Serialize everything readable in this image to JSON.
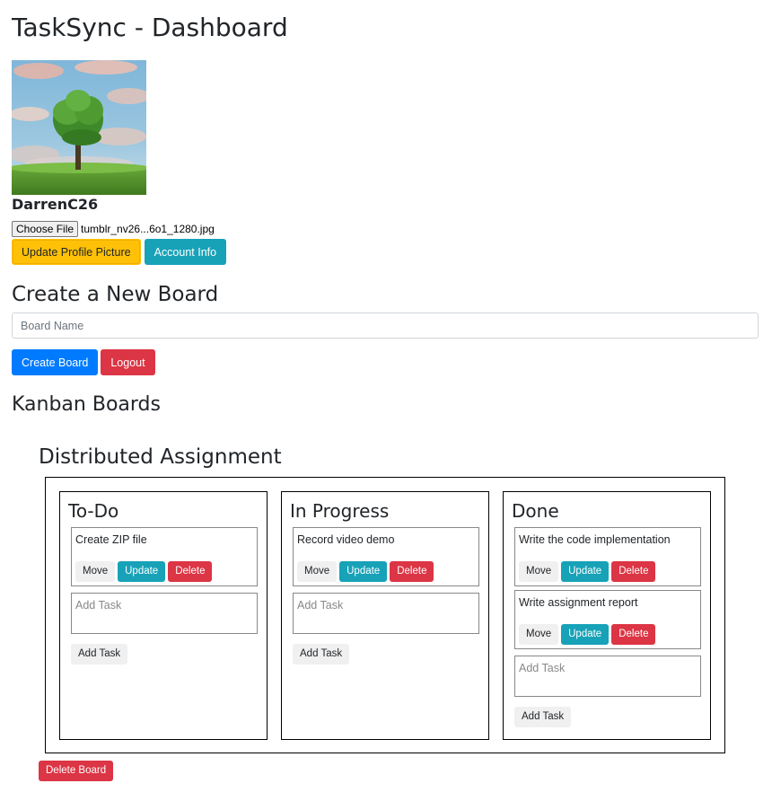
{
  "page": {
    "title": "TaskSync - Dashboard"
  },
  "profile": {
    "username": "DarrenC26",
    "choose_file_label": "Choose File",
    "file_name": "tumblr_nv26...6o1_1280.jpg",
    "update_picture_label": "Update Profile Picture",
    "account_info_label": "Account Info"
  },
  "create_board": {
    "heading": "Create a New Board",
    "placeholder": "Board Name",
    "create_label": "Create Board",
    "logout_label": "Logout"
  },
  "kanban": {
    "heading": "Kanban Boards",
    "boards": [
      {
        "title": "Distributed Assignment",
        "delete_label": "Delete Board",
        "columns": [
          {
            "title": "To-Do",
            "tasks": [
              {
                "name": "Create ZIP file"
              }
            ],
            "add_placeholder": "Add Task",
            "add_label": "Add Task"
          },
          {
            "title": "In Progress",
            "tasks": [
              {
                "name": "Record video demo"
              }
            ],
            "add_placeholder": "Add Task",
            "add_label": "Add Task"
          },
          {
            "title": "Done",
            "tasks": [
              {
                "name": "Write the code implementation"
              },
              {
                "name": "Write assignment report"
              }
            ],
            "add_placeholder": "Add Task",
            "add_label": "Add Task"
          }
        ]
      }
    ]
  },
  "task_actions": {
    "move": "Move",
    "update": "Update",
    "delete": "Delete"
  },
  "colors": {
    "primary": "#007bff",
    "info": "#17a2b8",
    "danger": "#dc3545",
    "warning": "#ffc107",
    "light": "#f0f0f0"
  }
}
